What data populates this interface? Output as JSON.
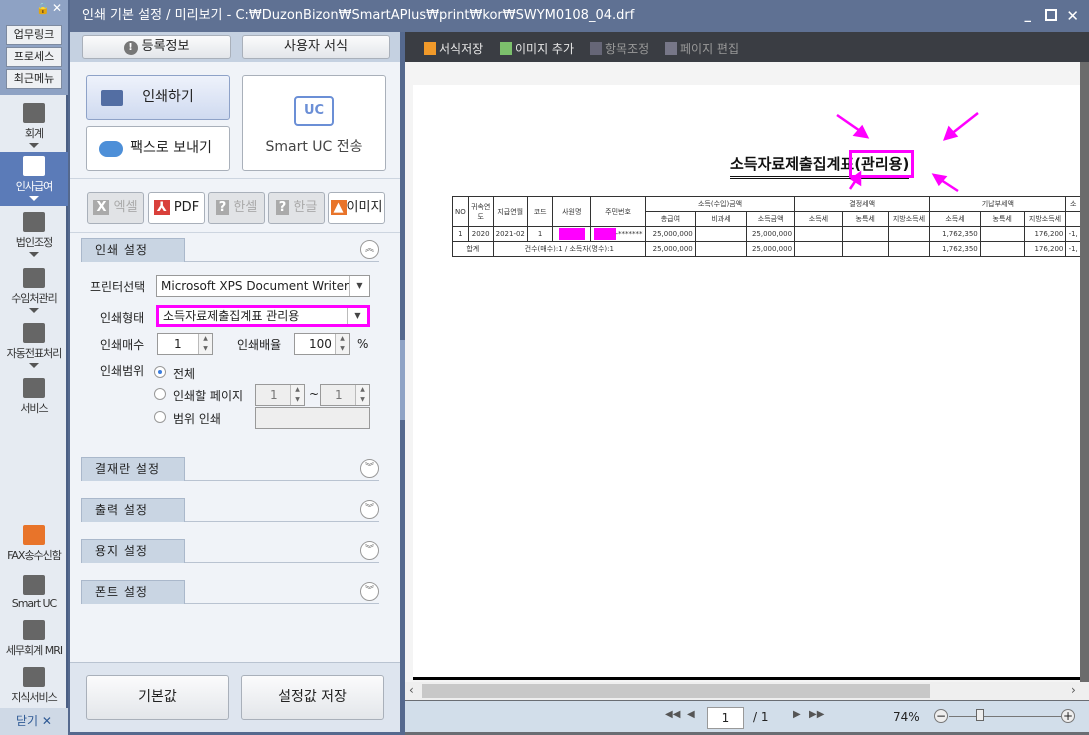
{
  "sidebar": {
    "top_buttons": [
      "업무링크",
      "프로세스",
      "최근메뉴"
    ],
    "items": [
      {
        "label": "회계",
        "icon": "calculator-icon"
      },
      {
        "label": "인사급여",
        "icon": "person-coins-icon",
        "selected": true
      },
      {
        "label": "법인조정",
        "icon": "building-icon"
      },
      {
        "label": "수임처관리",
        "icon": "client-icon"
      },
      {
        "label": "자동전표처리",
        "icon": "database-icon"
      },
      {
        "label": "서비스",
        "icon": "monitor-icon"
      }
    ],
    "bottom_items": [
      {
        "label": "FAX송수신함",
        "icon": "fax-icon"
      },
      {
        "label": "Smart UC",
        "icon": "uc-chat-icon"
      },
      {
        "label": "세무회계 MRI",
        "icon": "pulse-chart-icon"
      },
      {
        "label": "지식서비스",
        "icon": "book-icon"
      }
    ],
    "close_label": "닫기"
  },
  "window": {
    "title": "인쇄 기본 설정 / 미리보기 -   C:₩DuzonBizon₩SmartAPlus₩print₩kor₩SWYM0108_04.drf"
  },
  "panel": {
    "reg_info": "등록정보",
    "user_format": "사용자 서식",
    "print": "인쇄하기",
    "fax": "팩스로 보내기",
    "smart_uc": "Smart UC 전송",
    "uc_badge": "UC",
    "exports": [
      "엑셀",
      "PDF",
      "한셀",
      "한글",
      "이미지"
    ],
    "print_settings": {
      "title": "인쇄 설정",
      "printer_label": "프린터선택",
      "printer_value": "Microsoft XPS Document Writer",
      "type_label": "인쇄형태",
      "type_value": "소득자료제출집계표 관리용",
      "copies_label": "인쇄매수",
      "copies": "1",
      "scale_label": "인쇄배율",
      "scale": "100",
      "scale_unit": "%",
      "range_label": "인쇄범위",
      "range_all": "전체",
      "range_pages": "인쇄할 페이지",
      "page_from": "1",
      "tilde": "~",
      "page_to": "1",
      "range_custom": "범위 인쇄"
    },
    "sections": [
      "결재란 설정",
      "출력 설정",
      "용지 설정",
      "폰트 설정"
    ],
    "default_btn": "기본값",
    "save_btn": "설정값 저장"
  },
  "toolbar": [
    "서식저장",
    "이미지 추가",
    "항목조정",
    "페이지 편집"
  ],
  "report": {
    "title": "소득자료제출집계표",
    "title_suffix": "(관리용)",
    "headers_top": [
      "NO",
      "귀속연도",
      "지급연월",
      "코드",
      "사원명",
      "주민번호",
      "소득(수입)금액",
      "결정세액",
      "기납부세액",
      "소"
    ],
    "headers_sub": [
      "총급여",
      "비과세",
      "소득금액",
      "소득세",
      "농특세",
      "지방소득세",
      "소득세",
      "농특세",
      "지방소득세"
    ],
    "row": {
      "no": "1",
      "year": "2020",
      "month": "2021-02",
      "code": "1",
      "ssn_mask": "-*******",
      "total": "25,000,000",
      "nontax": "",
      "income": "25,000,000",
      "d_tax": "",
      "d_agri": "",
      "d_local": "",
      "p_tax": "1,762,350",
      "p_agri": "",
      "p_local": "176,200",
      "next": "-1,"
    },
    "total_row": {
      "label": "합계",
      "summary": "건수(매수):1 / 소득자(명수):1",
      "total": "25,000,000",
      "income": "25,000,000",
      "p_tax": "1,762,350",
      "p_local": "176,200",
      "next": "-1,"
    }
  },
  "pager": {
    "page": "1",
    "of": "/ 1",
    "zoom": "74%",
    "zoom_level_percent": 74
  },
  "colors": {
    "highlight": "#ff00ff",
    "selected_nav": "#5b7bb8",
    "titlebar": "#5f7193"
  }
}
